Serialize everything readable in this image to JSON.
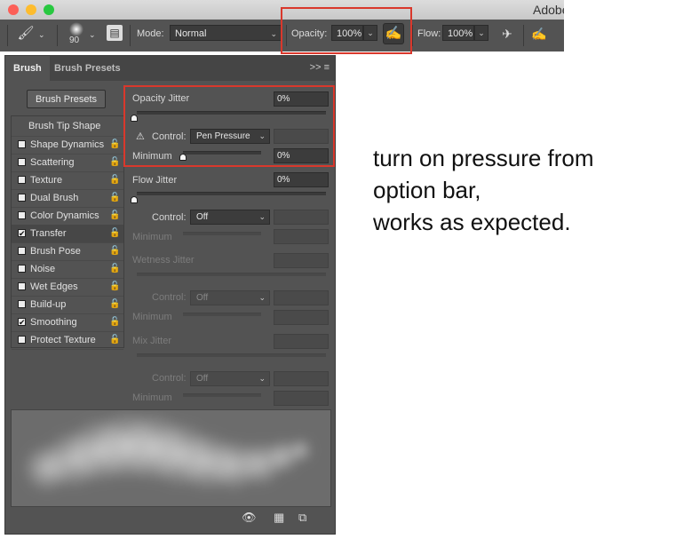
{
  "window": {
    "title": "Adobe",
    "traffic_lights": {
      "close": "#fc5f57",
      "minimize": "#fdbc2e",
      "zoom": "#28c840"
    }
  },
  "options_bar": {
    "brush_size": "90",
    "mode_label": "Mode:",
    "mode_value": "Normal",
    "opacity_label": "Opacity:",
    "opacity_value": "100%",
    "flow_label": "Flow:",
    "flow_value": "100%",
    "icons": [
      "brush-tool-icon",
      "brush-preset-picker-icon",
      "brush-settings-toggle-icon",
      "opacity-pressure-icon",
      "airbrush-icon",
      "size-pressure-icon"
    ]
  },
  "panel": {
    "tabs": [
      "Brush",
      "Brush Presets"
    ],
    "menu_glyphs": ">>  ≡",
    "brush_presets_button": "Brush Presets",
    "list": {
      "header": "Brush Tip Shape",
      "items": [
        {
          "label": "Shape Dynamics",
          "checked": false
        },
        {
          "label": "Scattering",
          "checked": false
        },
        {
          "label": "Texture",
          "checked": false
        },
        {
          "label": "Dual Brush",
          "checked": false
        },
        {
          "label": "Color Dynamics",
          "checked": false
        },
        {
          "label": "Transfer",
          "checked": true
        },
        {
          "label": "Brush Pose",
          "checked": false
        },
        {
          "label": "Noise",
          "checked": false
        },
        {
          "label": "Wet Edges",
          "checked": false
        },
        {
          "label": "Build-up",
          "checked": false
        },
        {
          "label": "Smoothing",
          "checked": true
        },
        {
          "label": "Protect Texture",
          "checked": false
        }
      ]
    },
    "transfer": {
      "opacity_jitter": {
        "label": "Opacity Jitter",
        "value": "0%",
        "control_label": "Control:",
        "control_value": "Pen Pressure",
        "minimum_label": "Minimum",
        "minimum_value": "0%"
      },
      "flow_jitter": {
        "label": "Flow Jitter",
        "value": "0%",
        "control_label": "Control:",
        "control_value": "Off",
        "minimum_label": "Minimum"
      },
      "wetness_jitter": {
        "label": "Wetness Jitter",
        "control_label": "Control:",
        "control_value": "Off",
        "minimum_label": "Minimum"
      },
      "mix_jitter": {
        "label": "Mix Jitter",
        "control_label": "Control:",
        "control_value": "Off",
        "minimum_label": "Minimum"
      }
    }
  },
  "annotation": {
    "lines": [
      "turn on pressure from",
      "option bar,",
      "works as expected."
    ],
    "highlight_color": "#d9382c"
  }
}
